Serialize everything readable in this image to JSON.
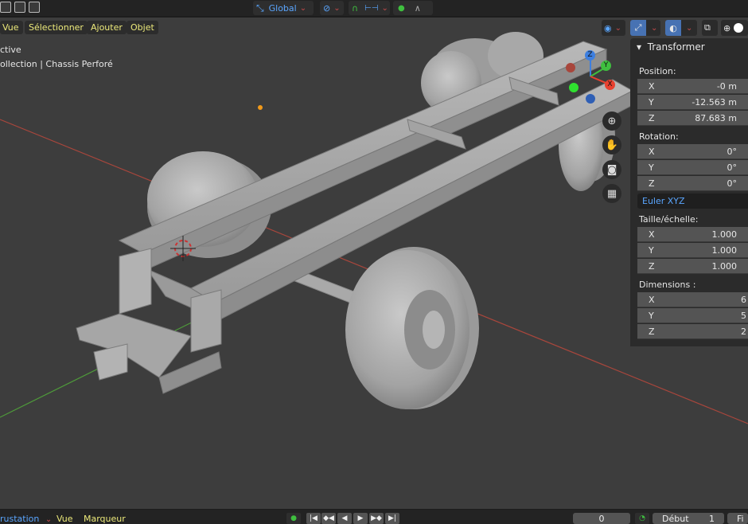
{
  "top": {
    "transform_orientation": "Global"
  },
  "menu": {
    "view": "Vue",
    "select": "Sélectionner",
    "add": "Ajouter",
    "object": "Objet"
  },
  "overlay": {
    "mode_line": "ctive",
    "collection_line": "ollection | Chassis Perforé"
  },
  "npanel": {
    "title": "Transformer",
    "position_label": "Position:",
    "position": [
      {
        "axis": "X",
        "value": "-0 m"
      },
      {
        "axis": "Y",
        "value": "-12.563 m"
      },
      {
        "axis": "Z",
        "value": "87.683 m"
      }
    ],
    "rotation_label": "Rotation:",
    "rotation": [
      {
        "axis": "X",
        "value": "0°"
      },
      {
        "axis": "Y",
        "value": "0°"
      },
      {
        "axis": "Z",
        "value": "0°"
      }
    ],
    "rotation_mode": "Euler XYZ",
    "scale_label": "Taille/échelle:",
    "scale": [
      {
        "axis": "X",
        "value": "1.000"
      },
      {
        "axis": "Y",
        "value": "1.000"
      },
      {
        "axis": "Z",
        "value": "1.000"
      }
    ],
    "dimensions_label": "Dimensions  :",
    "dimensions": [
      {
        "axis": "X",
        "value": "6"
      },
      {
        "axis": "Y",
        "value": "5"
      },
      {
        "axis": "Z",
        "value": "2"
      }
    ]
  },
  "gizmo": {
    "z": "Z",
    "y": "Y",
    "x": "X"
  },
  "timeline": {
    "editor": "rustation",
    "view": "Vue",
    "marker": "Marqueur",
    "current_frame": "0",
    "start_label": "Début",
    "start_value": "1",
    "end_label": "Fi"
  },
  "colors": {
    "accent_blue": "#5aa6ff",
    "menu_yellow": "#ece97a",
    "axis_x": "#e8402f",
    "axis_y": "#3fbf3f",
    "axis_z": "#3d7fe0"
  }
}
